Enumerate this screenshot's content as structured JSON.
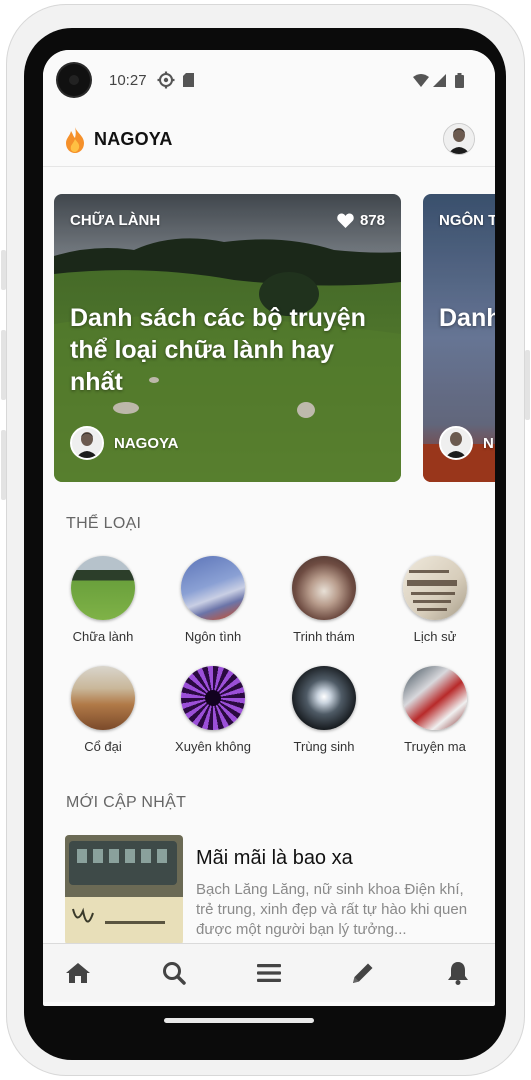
{
  "status_bar": {
    "time": "10:27"
  },
  "app_bar": {
    "brand": "NAGOYA"
  },
  "featured": [
    {
      "tag": "CHỮA LÀNH",
      "likes": "878",
      "title": "Danh sách các bộ truyện thể loại chữa lành hay nhất",
      "author": "NAGOYA"
    },
    {
      "tag": "NGÔN T",
      "title": "Danh thể l nhất",
      "author": "N"
    }
  ],
  "sections": {
    "genres_label": "THỂ LOẠI",
    "updates_label": "MỚI CẬP NHẬT"
  },
  "genres": [
    {
      "label": "Chữa lành"
    },
    {
      "label": "Ngôn tình"
    },
    {
      "label": "Trinh thám"
    },
    {
      "label": "Lịch sử"
    },
    {
      "label": "Cổ đại"
    },
    {
      "label": "Xuyên không"
    },
    {
      "label": "Trùng sinh"
    },
    {
      "label": "Truyện ma"
    }
  ],
  "latest": {
    "title": "Mãi mãi là bao xa",
    "description": "Bạch Lăng Lăng, nữ sinh khoa Điện khí, trẻ trung, xinh đẹp và rất tự hào khi quen được một người bạn lý tưởng..."
  },
  "bottom_nav": [
    "home-icon",
    "search-icon",
    "menu-icon",
    "pencil-icon",
    "bell-icon"
  ],
  "colors": {
    "flame": "#f5902a",
    "text_dark": "#111111",
    "muted": "#8a8a8a"
  }
}
